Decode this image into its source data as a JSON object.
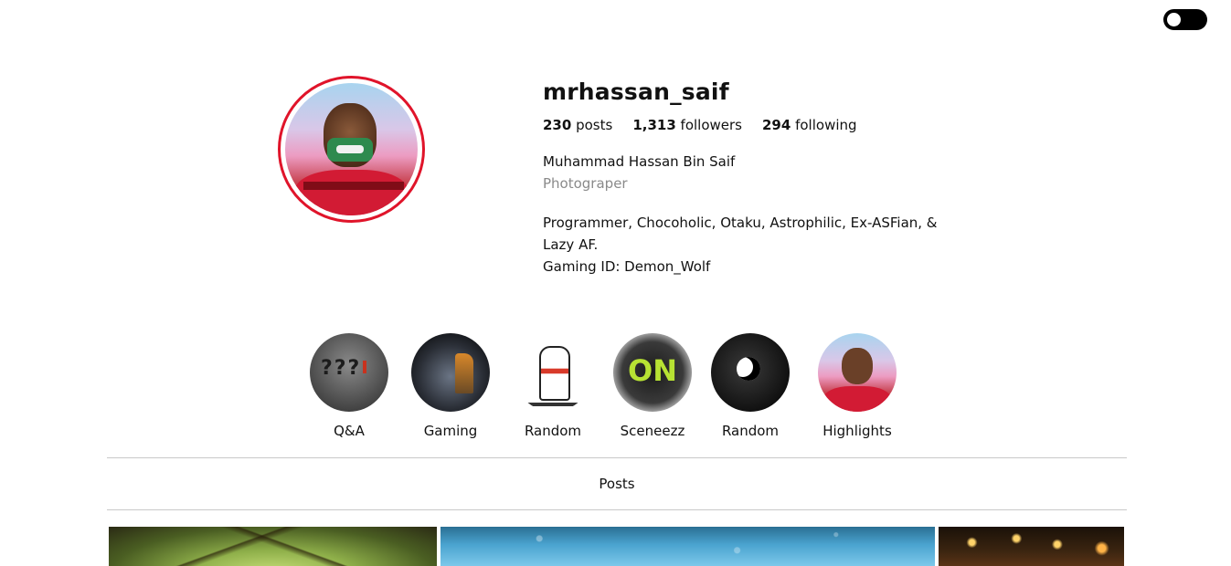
{
  "theme_toggle": {
    "state": "dark-off",
    "icon": "toggle-icon"
  },
  "profile": {
    "username": "mrhassan_saif",
    "stats": {
      "posts_count": "230",
      "posts_label": "posts",
      "followers_count": "1,313",
      "followers_label": "followers",
      "following_count": "294",
      "following_label": "following"
    },
    "full_name": "Muhammad Hassan Bin Saif",
    "category": "Photograper",
    "bio_lines": [
      "Programmer, Chocoholic, Otaku, Astrophilic, Ex-ASFian, & Lazy AF.",
      "Gaming ID: Demon_Wolf"
    ],
    "avatar_ring_color": "#e0142a"
  },
  "highlights": [
    {
      "label": "Q&A"
    },
    {
      "label": "Gaming"
    },
    {
      "label": "Random"
    },
    {
      "label": "Sceneezz"
    },
    {
      "label": "Random"
    },
    {
      "label": "Highlights"
    }
  ],
  "tabs": {
    "posts_label": "Posts"
  },
  "posts": [
    {
      "subject": "trees-canopy"
    },
    {
      "subject": "rain-water"
    },
    {
      "subject": "candles"
    }
  ]
}
